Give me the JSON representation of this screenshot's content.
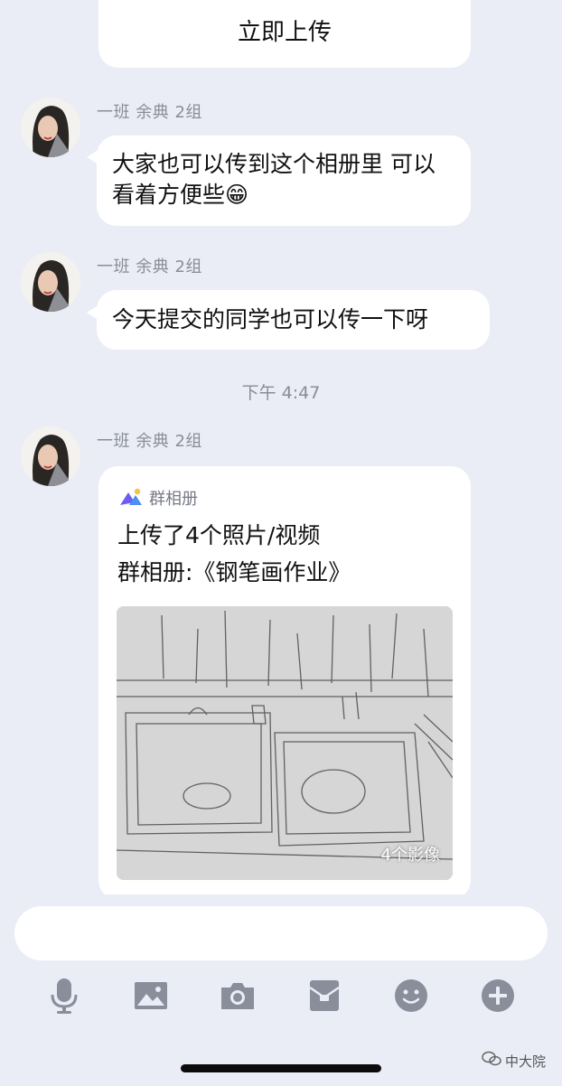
{
  "upload_card": {
    "label": "立即上传"
  },
  "messages": [
    {
      "sender": "一班 余典 2组",
      "text": "大家也可以传到这个相册里 可以看着方便些",
      "emoji": "😁"
    },
    {
      "sender": "一班 余典 2组",
      "text": "今天提交的同学也可以传一下呀"
    },
    {
      "sender": "一班 余典 2组"
    }
  ],
  "timestamp": "下午 4:47",
  "album": {
    "app_name": "群相册",
    "line1": "上传了4个照片/视频",
    "line2": "群相册:《钢笔画作业》",
    "photo_count": "4个影像"
  },
  "input": {
    "placeholder": ""
  },
  "toolbar": [
    "mic-icon",
    "image-icon",
    "camera-icon",
    "red-packet-icon",
    "emoji-icon",
    "plus-icon"
  ],
  "watermark": {
    "label": "中大院"
  },
  "colors": {
    "background": "#eaedf6",
    "bubble": "#ffffff",
    "meta_text": "#8a8d97",
    "icon": "#8a8d9a"
  }
}
